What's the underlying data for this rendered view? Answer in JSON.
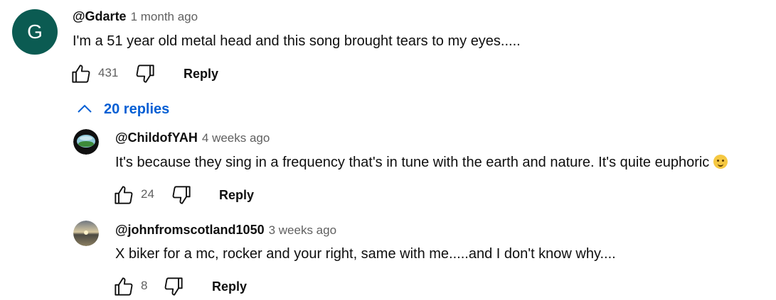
{
  "comment": {
    "avatar_letter": "G",
    "avatar_color": "#0b5b52",
    "author": "@Gdarte",
    "time": "1 month ago",
    "text": "I'm a 51 year old metal  head and this song brought tears to my eyes.....",
    "likes": "431",
    "reply_label": "Reply",
    "replies_toggle": "20 replies"
  },
  "replies": [
    {
      "author": "@ChildofYAH",
      "time": "4 weeks ago",
      "text": "It's because they sing in a frequency that's in tune with the earth and nature. It's quite euphoric",
      "likes": "24",
      "reply_label": "Reply"
    },
    {
      "author": "@johnfromscotland1050",
      "time": "3 weeks ago",
      "text": "X biker for a mc, rocker and your right, same with me.....and I don't know why....",
      "likes": "8",
      "reply_label": "Reply"
    }
  ],
  "colors": {
    "link": "#065fd4",
    "meta": "#606060"
  }
}
